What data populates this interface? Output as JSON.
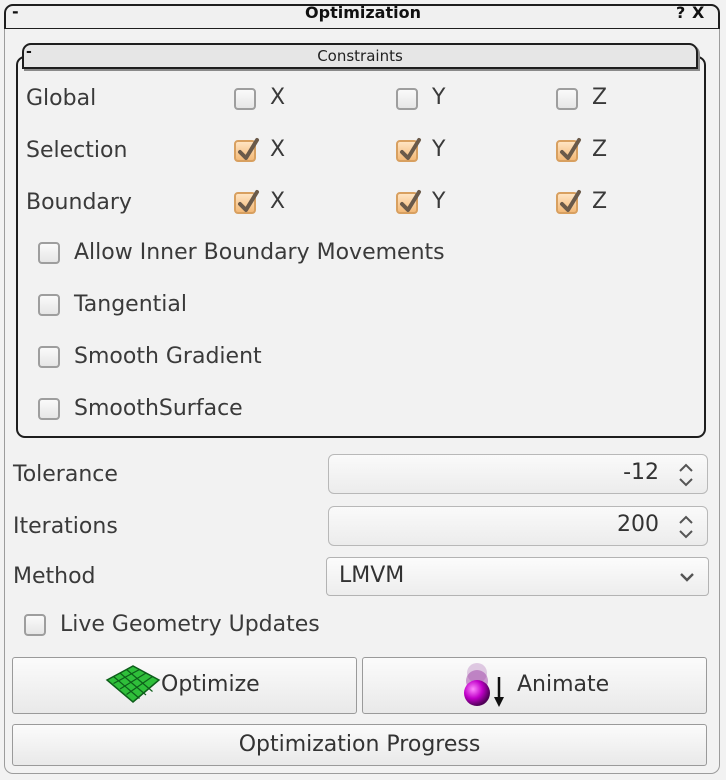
{
  "window": {
    "title": "Optimization",
    "collapse_label": "-",
    "help_label": "?",
    "close_label": "X"
  },
  "constraints": {
    "title": "Constraints",
    "collapse_label": "-",
    "axis_labels": [
      "X",
      "Y",
      "Z"
    ],
    "rows": [
      {
        "label": "Global",
        "x": false,
        "y": false,
        "z": false
      },
      {
        "label": "Selection",
        "x": true,
        "y": true,
        "z": true
      },
      {
        "label": "Boundary",
        "x": true,
        "y": true,
        "z": true
      }
    ],
    "options": [
      {
        "label": "Allow Inner Boundary Movements",
        "checked": false
      },
      {
        "label": "Tangential",
        "checked": false
      },
      {
        "label": "Smooth Gradient",
        "checked": false
      },
      {
        "label": "SmoothSurface",
        "checked": false
      }
    ]
  },
  "tolerance": {
    "label": "Tolerance",
    "value": "-12"
  },
  "iterations": {
    "label": "Iterations",
    "value": "200"
  },
  "method": {
    "label": "Method",
    "value": "LMVM"
  },
  "live_updates": {
    "label": "Live Geometry Updates",
    "checked": false
  },
  "buttons": {
    "optimize": "Optimize",
    "animate": "Animate",
    "progress": "Optimization Progress"
  },
  "colors": {
    "checked_fill": "#f3b978",
    "check_mark": "#6a5a4a",
    "border_dark": "#1e1e1e"
  }
}
